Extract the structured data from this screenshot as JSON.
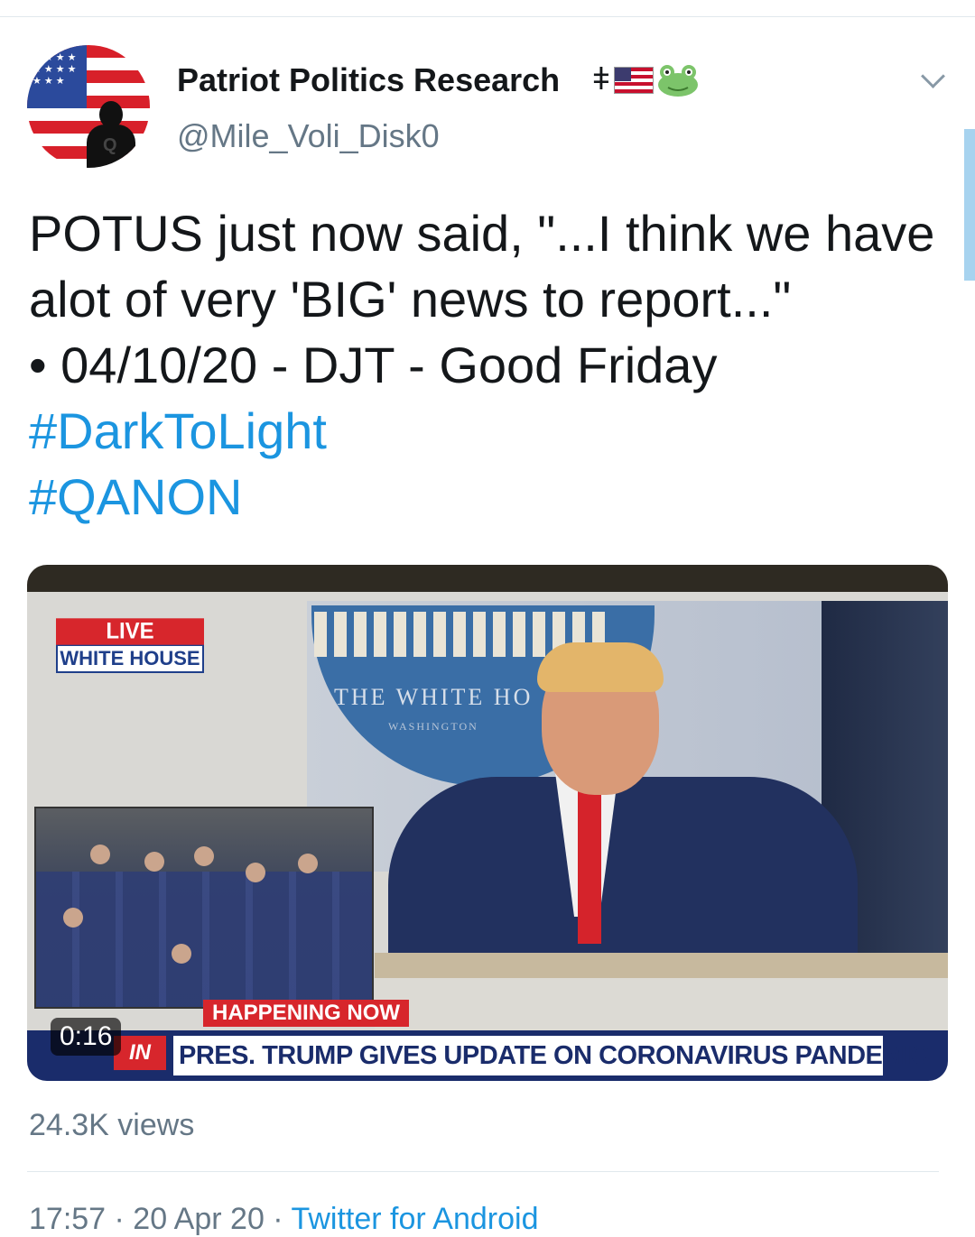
{
  "tweet": {
    "author": {
      "display_name": "Patriot Politics Research",
      "name_glyph": "ǂ",
      "handle": "@Mile_Voli_Disk0",
      "avatar_icon": "flag-silhouette-avatar",
      "badges": [
        "us-flag-icon",
        "frog-icon"
      ]
    },
    "text_lines": [
      "POTUS just now said, \"...I think we have",
      "alot of very 'BIG' news to report...\"",
      "• 04/10/20 - DJT - Good Friday"
    ],
    "hashtags": [
      "#DarkToLight",
      "#QANON"
    ],
    "media": {
      "live_label": "LIVE",
      "live_sublabel": "WHITE HOUSE",
      "backdrop_text": "THE WHITE HO",
      "backdrop_subtext": "WASHINGTON",
      "banner": "HAPPENING NOW",
      "network_logo": "IN",
      "headline": "PRES. TRUMP GIVES UPDATE ON CORONAVIRUS PANDEMIC",
      "duration": "0:16"
    },
    "views": "24.3K views",
    "meta": {
      "time_date": "17:57 · 20 Apr 20 · ",
      "source": "Twitter for Android"
    }
  },
  "colors": {
    "link": "#1b95e0",
    "secondary_text": "#657786",
    "divider": "#e1e8ed",
    "news_red": "#d7262c",
    "news_blue": "#1a2c6b"
  }
}
